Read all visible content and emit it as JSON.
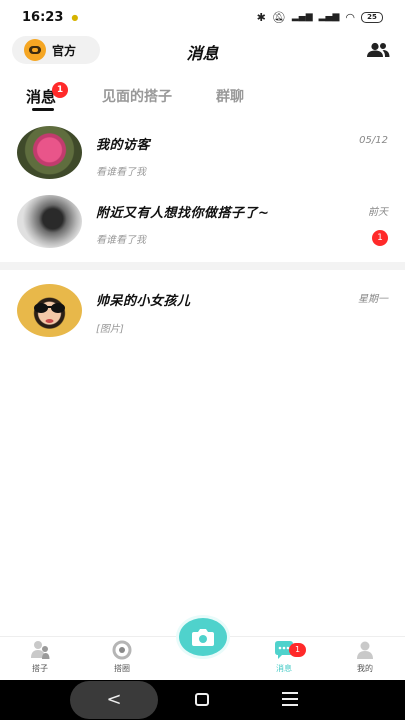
{
  "status_bar": {
    "time": "16:23",
    "battery": "25",
    "icons": [
      "bluetooth-icon",
      "mute-icon",
      "hd-signal-icon",
      "hd-signal-icon",
      "wifi-icon",
      "battery-icon"
    ]
  },
  "header": {
    "official_label": "官方",
    "title": "消息",
    "contacts_icon": "contacts-icon"
  },
  "tabs": [
    {
      "label": "消息",
      "badge": "1",
      "active": true
    },
    {
      "label": "见面的搭子",
      "active": false
    },
    {
      "label": "群聊",
      "active": false
    }
  ],
  "messages": [
    {
      "title": "我的访客",
      "subtitle": "看谁看了我",
      "time": "05/12",
      "avatar": "rose-flower-avatar"
    },
    {
      "title": "附近又有人想找你做搭子了~",
      "subtitle": "看谁看了我",
      "time": "前天",
      "badge": "1",
      "avatar": "blurred-avatar"
    },
    {
      "title": "帅呆的小女孩儿",
      "subtitle": "[图片]",
      "time": "星期一",
      "avatar": "girl-sunglasses-avatar"
    }
  ],
  "bottom_nav": {
    "items": [
      {
        "label": "搭子",
        "icon": "people-icon"
      },
      {
        "label": "搭圈",
        "icon": "circle-icon"
      },
      {
        "label": "消息",
        "icon": "chat-bubble-icon",
        "badge": "1",
        "active": true
      },
      {
        "label": "我的",
        "icon": "profile-icon"
      }
    ],
    "camera_icon": "camera-icon"
  },
  "colors": {
    "accent": "#4fd2cc",
    "badge": "#ff2a2a",
    "official": "#f5a623"
  }
}
